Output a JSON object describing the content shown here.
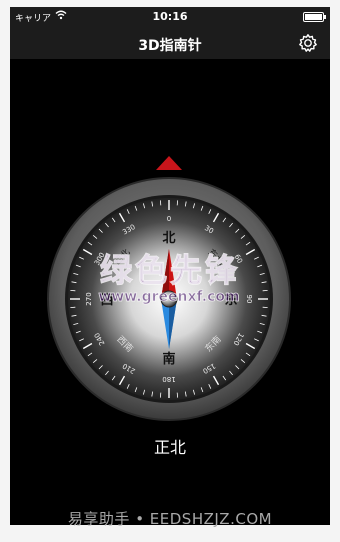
{
  "status_bar": {
    "carrier": "キャリア",
    "time": "10:16"
  },
  "nav": {
    "title": "3D指南针",
    "settings_icon": "gear-icon"
  },
  "compass": {
    "heading_deg": 0,
    "cardinals": {
      "north": "北",
      "south": "南",
      "east": "东",
      "west": "西"
    },
    "intercardinals": {
      "ne": "东北",
      "se": "东南",
      "sw": "西南",
      "nw": "西北"
    },
    "degree_labels": [
      "0",
      "30",
      "60",
      "90",
      "120",
      "150",
      "180",
      "210",
      "240",
      "270",
      "300",
      "330"
    ],
    "colors": {
      "north_needle": "#cc1414",
      "south_needle": "#2a8ae0",
      "indicator": "#c8151b"
    }
  },
  "direction_text": "正北",
  "overlay": {
    "title": "绿色先锋",
    "url": "www.greenxf.com"
  },
  "watermark": "易享助手 • EEDSHZJZ.COM"
}
